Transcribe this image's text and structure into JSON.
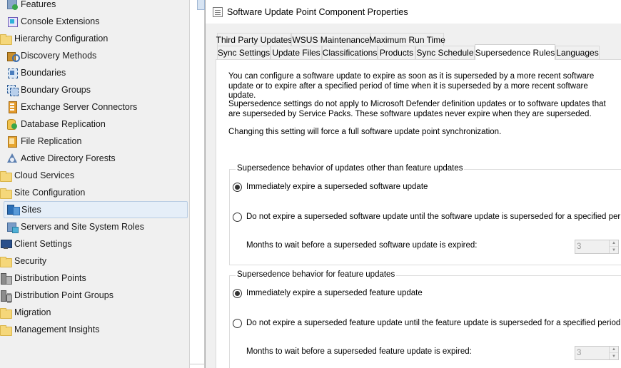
{
  "nav": {
    "items": [
      {
        "label": "Features",
        "icon": "features-icon"
      },
      {
        "label": "Console Extensions",
        "icon": "console-extensions-icon"
      },
      {
        "label": "Hierarchy Configuration",
        "icon": "folder-icon"
      },
      {
        "label": "Discovery Methods",
        "icon": "discovery-methods-icon"
      },
      {
        "label": "Boundaries",
        "icon": "boundaries-icon"
      },
      {
        "label": "Boundary Groups",
        "icon": "boundary-groups-icon"
      },
      {
        "label": "Exchange Server Connectors",
        "icon": "exchange-connector-icon"
      },
      {
        "label": "Database Replication",
        "icon": "database-replication-icon"
      },
      {
        "label": "File Replication",
        "icon": "file-replication-icon"
      },
      {
        "label": "Active Directory Forests",
        "icon": "ad-forests-icon"
      },
      {
        "label": "Cloud Services",
        "icon": "folder-icon"
      },
      {
        "label": "Site Configuration",
        "icon": "folder-icon"
      },
      {
        "label": "Sites",
        "icon": "sites-icon",
        "selected": true
      },
      {
        "label": "Servers and Site System Roles",
        "icon": "servers-roles-icon"
      },
      {
        "label": "Client Settings",
        "icon": "client-settings-icon"
      },
      {
        "label": "Security",
        "icon": "folder-icon"
      },
      {
        "label": "Distribution Points",
        "icon": "distribution-points-icon"
      },
      {
        "label": "Distribution Point Groups",
        "icon": "distribution-point-groups-icon"
      },
      {
        "label": "Migration",
        "icon": "folder-icon"
      },
      {
        "label": "Management Insights",
        "icon": "folder-icon"
      }
    ]
  },
  "dialog": {
    "title": "Software Update Point Component Properties",
    "tabs_row1": [
      "Third Party Updates",
      "WSUS Maintenance",
      "Maximum Run Time"
    ],
    "tabs_row2": [
      "Sync Settings",
      "Update Files",
      "Classifications",
      "Products",
      "Sync Schedule",
      "Supersedence Rules",
      "Languages"
    ],
    "active_tab": "Supersedence Rules",
    "description_1": "You can configure a software update to expire as soon as it is superseded by a more recent software update or to expire after a specified period of time when it is superseded by a more recent software update.",
    "description_2": "Supersedence settings do not apply to Microsoft Defender definition updates or to software updates that are superseded by Service Packs. These software updates never expire when they are superseded.",
    "description_3": "Changing this setting will force a full software update point synchronization.",
    "group1": {
      "legend": "Supersedence behavior of updates other than feature updates",
      "option_immediate": "Immediately expire a superseded software update",
      "option_wait": "Do not expire a superseded software update until the software update is superseded for a specified period",
      "selected": "immediate",
      "months_label": "Months to wait before a superseded software update is expired:",
      "months_value": "3"
    },
    "group2": {
      "legend": "Supersedence behavior for feature updates",
      "option_immediate": "Immediately expire a superseded feature update",
      "option_wait": "Do not expire a superseded feature update until the feature update is superseded for a specified period",
      "selected": "immediate",
      "months_label": "Months to wait before a superseded feature update is expired:",
      "months_value": "3"
    }
  }
}
